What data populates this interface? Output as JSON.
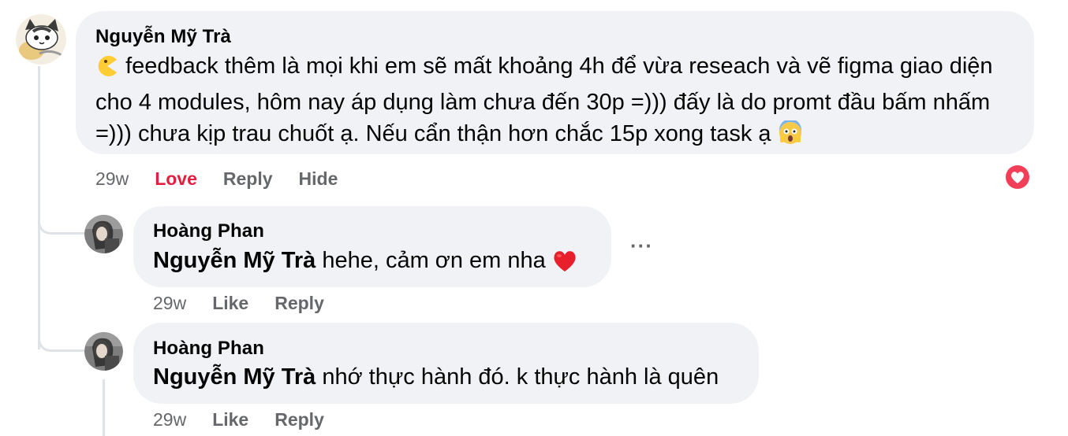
{
  "comments": [
    {
      "author": "Nguyễn Mỹ Trà",
      "text_1": "feedback thêm là mọi khi em sẽ mất khoảng 4h để vừa reseach và vẽ figma giao diện cho 4 modules, hôm nay áp dụng làm chưa đến 30p =))) đấy là do promt đầu bấm nhấm =))) chưa kịp trau chuốt ạ. Nếu cẩn thận hơn chắc 15p xong task ạ",
      "time": "29w",
      "reaction_label": "Love",
      "reply_label": "Reply",
      "hide_label": "Hide",
      "reaction_icon": "heart-reaction-icon",
      "leading_icon": "pacman-face-emoji-icon",
      "trailing_icon": "face-screaming-emoji-icon"
    }
  ],
  "replies": [
    {
      "author": "Hoàng Phan",
      "mention": "Nguyễn Mỹ Trà",
      "text": " hehe, cảm ơn em nha ",
      "trailing_icon": "red-heart-emoji-icon",
      "time": "29w",
      "like_label": "Like",
      "reply_label": "Reply",
      "more_label": "···"
    },
    {
      "author": "Hoàng Phan",
      "mention": "Nguyễn Mỹ Trà",
      "text": " nhớ thực hành đó. k thực hành là quên",
      "time": "29w",
      "like_label": "Like",
      "reply_label": "Reply"
    }
  ],
  "colors": {
    "bubble": "#f0f2f5",
    "meta_text": "#65676b",
    "love": "#e41e3f",
    "thread_line": "#dfe2e6"
  }
}
